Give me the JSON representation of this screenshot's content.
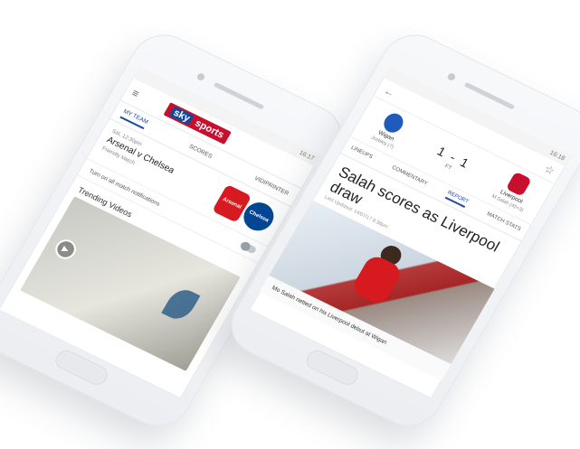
{
  "phone1": {
    "status": "16:17",
    "brand": {
      "sky": "sky",
      "sports": "sports"
    },
    "tabs": [
      "MY TEAM",
      "SCORES",
      "VIDIPRINTER"
    ],
    "match": {
      "time": "Sat, 12:30pm",
      "teams": "Arsenal v Chelsea",
      "type": "Friendly Match"
    },
    "badges": {
      "arsenal": "Arsenal",
      "chelsea": "Chelsea"
    },
    "notify": "Turn on all match notifications",
    "section": "Trending Videos"
  },
  "phone2": {
    "status": "16:18",
    "home_team": "Wigan",
    "home_scorer": "Jcobley (7)",
    "away_team": "Liverpool",
    "away_scorer": "M Salah (45+3)",
    "score": "1 - 1",
    "status_label": "FT",
    "tabs": [
      "LINEUPS",
      "COMMENTARY",
      "REPORT",
      "MATCH STATS"
    ],
    "headline": "Salah scores as Liverpool draw",
    "updated": "Last Updated: 14/07/17 9:38pm",
    "caption": "Mo Salah netted on his Liverpool debut at Wigan"
  },
  "icons": {
    "back": "back-arrow-icon",
    "star": "star-icon",
    "menu": "hamburger-icon",
    "play": "play-icon"
  }
}
